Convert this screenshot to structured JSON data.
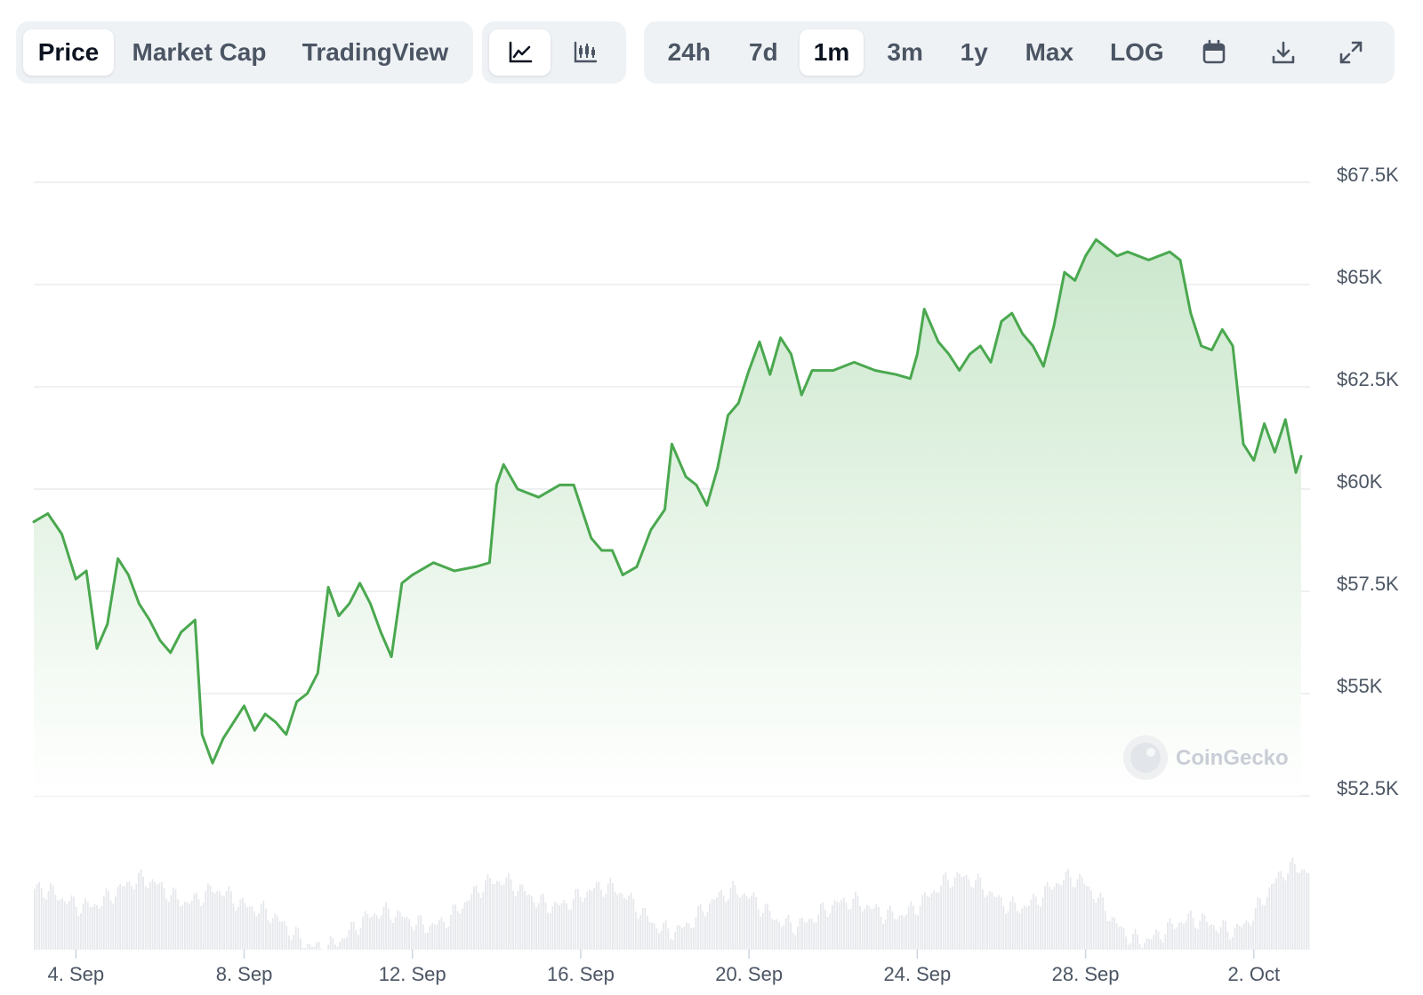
{
  "toolbar": {
    "view_tabs": [
      {
        "label": "Price",
        "active": true
      },
      {
        "label": "Market Cap",
        "active": false
      },
      {
        "label": "TradingView",
        "active": false
      }
    ],
    "chart_types": [
      {
        "icon": "line-chart-icon",
        "active": true
      },
      {
        "icon": "candlestick-chart-icon",
        "active": false
      }
    ],
    "ranges": [
      {
        "label": "24h",
        "active": false
      },
      {
        "label": "7d",
        "active": false
      },
      {
        "label": "1m",
        "active": true
      },
      {
        "label": "3m",
        "active": false
      },
      {
        "label": "1y",
        "active": false
      },
      {
        "label": "Max",
        "active": false
      }
    ],
    "log_label": "LOG",
    "icons": [
      "calendar-icon",
      "download-icon",
      "expand-icon"
    ]
  },
  "watermark": "CoinGecko",
  "colors": {
    "line": "#4aa84f",
    "fill_top": "#c8e6c9",
    "grid": "#e5e7eb",
    "volume": "#e6e8ec",
    "active_bg": "#ffffff",
    "group_bg": "#eff2f5"
  },
  "chart_data": {
    "type": "area",
    "x_axis_type": "date",
    "xlim": [
      "2024-09-03",
      "2024-10-03"
    ],
    "y_axis_labels": [
      "$52.5K",
      "$55K",
      "$57.5K",
      "$60K",
      "$62.5K",
      "$65K",
      "$67.5K"
    ],
    "ylim": [
      52500,
      67500
    ],
    "x_axis_labels": [
      "4. Sep",
      "8. Sep",
      "12. Sep",
      "16. Sep",
      "20. Sep",
      "24. Sep",
      "28. Sep",
      "2. Oct"
    ],
    "x_axis_label_dates": [
      "2024-09-04",
      "2024-09-08",
      "2024-09-12",
      "2024-09-16",
      "2024-09-20",
      "2024-09-24",
      "2024-09-28",
      "2024-10-02"
    ],
    "grid": true,
    "series": [
      {
        "values": [
          [
            "2024-09-03T00:00",
            59200
          ],
          [
            "2024-09-03T08:00",
            59400
          ],
          [
            "2024-09-03T16:00",
            58900
          ],
          [
            "2024-09-04T00:00",
            57800
          ],
          [
            "2024-09-04T06:00",
            58000
          ],
          [
            "2024-09-04T12:00",
            56100
          ],
          [
            "2024-09-04T18:00",
            56700
          ],
          [
            "2024-09-05T00:00",
            58300
          ],
          [
            "2024-09-05T06:00",
            57900
          ],
          [
            "2024-09-05T12:00",
            57200
          ],
          [
            "2024-09-05T18:00",
            56800
          ],
          [
            "2024-09-06T00:00",
            56300
          ],
          [
            "2024-09-06T06:00",
            56000
          ],
          [
            "2024-09-06T12:00",
            56500
          ],
          [
            "2024-09-06T20:00",
            56800
          ],
          [
            "2024-09-07T00:00",
            54000
          ],
          [
            "2024-09-07T06:00",
            53300
          ],
          [
            "2024-09-07T12:00",
            53900
          ],
          [
            "2024-09-07T18:00",
            54300
          ],
          [
            "2024-09-08T00:00",
            54700
          ],
          [
            "2024-09-08T06:00",
            54100
          ],
          [
            "2024-09-08T12:00",
            54500
          ],
          [
            "2024-09-08T18:00",
            54300
          ],
          [
            "2024-09-09T00:00",
            54000
          ],
          [
            "2024-09-09T06:00",
            54800
          ],
          [
            "2024-09-09T12:00",
            55000
          ],
          [
            "2024-09-09T18:00",
            55500
          ],
          [
            "2024-09-10T00:00",
            57600
          ],
          [
            "2024-09-10T06:00",
            56900
          ],
          [
            "2024-09-10T12:00",
            57200
          ],
          [
            "2024-09-10T18:00",
            57700
          ],
          [
            "2024-09-11T00:00",
            57200
          ],
          [
            "2024-09-11T06:00",
            56500
          ],
          [
            "2024-09-11T12:00",
            55900
          ],
          [
            "2024-09-11T18:00",
            57700
          ],
          [
            "2024-09-12T00:00",
            57900
          ],
          [
            "2024-09-12T12:00",
            58200
          ],
          [
            "2024-09-13T00:00",
            58000
          ],
          [
            "2024-09-13T12:00",
            58100
          ],
          [
            "2024-09-13T20:00",
            58200
          ],
          [
            "2024-09-14T00:00",
            60100
          ],
          [
            "2024-09-14T04:00",
            60600
          ],
          [
            "2024-09-14T12:00",
            60000
          ],
          [
            "2024-09-15T00:00",
            59800
          ],
          [
            "2024-09-15T12:00",
            60100
          ],
          [
            "2024-09-15T20:00",
            60100
          ],
          [
            "2024-09-16T06:00",
            58800
          ],
          [
            "2024-09-16T12:00",
            58500
          ],
          [
            "2024-09-16T18:00",
            58500
          ],
          [
            "2024-09-17T00:00",
            57900
          ],
          [
            "2024-09-17T08:00",
            58100
          ],
          [
            "2024-09-17T16:00",
            59000
          ],
          [
            "2024-09-18T00:00",
            59500
          ],
          [
            "2024-09-18T04:00",
            61100
          ],
          [
            "2024-09-18T12:00",
            60300
          ],
          [
            "2024-09-18T18:00",
            60100
          ],
          [
            "2024-09-19T00:00",
            59600
          ],
          [
            "2024-09-19T06:00",
            60500
          ],
          [
            "2024-09-19T12:00",
            61800
          ],
          [
            "2024-09-19T18:00",
            62100
          ],
          [
            "2024-09-20T00:00",
            62900
          ],
          [
            "2024-09-20T06:00",
            63600
          ],
          [
            "2024-09-20T12:00",
            62800
          ],
          [
            "2024-09-20T18:00",
            63700
          ],
          [
            "2024-09-21T00:00",
            63300
          ],
          [
            "2024-09-21T06:00",
            62300
          ],
          [
            "2024-09-21T12:00",
            62900
          ],
          [
            "2024-09-22T00:00",
            62900
          ],
          [
            "2024-09-22T12:00",
            63100
          ],
          [
            "2024-09-23T00:00",
            62900
          ],
          [
            "2024-09-23T12:00",
            62800
          ],
          [
            "2024-09-23T20:00",
            62700
          ],
          [
            "2024-09-24T00:00",
            63300
          ],
          [
            "2024-09-24T04:00",
            64400
          ],
          [
            "2024-09-24T12:00",
            63600
          ],
          [
            "2024-09-24T18:00",
            63300
          ],
          [
            "2024-09-25T00:00",
            62900
          ],
          [
            "2024-09-25T06:00",
            63300
          ],
          [
            "2024-09-25T12:00",
            63500
          ],
          [
            "2024-09-25T18:00",
            63100
          ],
          [
            "2024-09-26T00:00",
            64100
          ],
          [
            "2024-09-26T06:00",
            64300
          ],
          [
            "2024-09-26T12:00",
            63800
          ],
          [
            "2024-09-26T18:00",
            63500
          ],
          [
            "2024-09-27T00:00",
            63000
          ],
          [
            "2024-09-27T06:00",
            64000
          ],
          [
            "2024-09-27T12:00",
            65300
          ],
          [
            "2024-09-27T18:00",
            65100
          ],
          [
            "2024-09-28T00:00",
            65700
          ],
          [
            "2024-09-28T06:00",
            66100
          ],
          [
            "2024-09-28T12:00",
            65900
          ],
          [
            "2024-09-28T18:00",
            65700
          ],
          [
            "2024-09-29T00:00",
            65800
          ],
          [
            "2024-09-29T12:00",
            65600
          ],
          [
            "2024-09-30T00:00",
            65800
          ],
          [
            "2024-09-30T06:00",
            65600
          ],
          [
            "2024-09-30T12:00",
            64300
          ],
          [
            "2024-09-30T18:00",
            63500
          ],
          [
            "2024-10-01T00:00",
            63400
          ],
          [
            "2024-10-01T06:00",
            63900
          ],
          [
            "2024-10-01T12:00",
            63500
          ],
          [
            "2024-10-01T18:00",
            61100
          ],
          [
            "2024-10-02T00:00",
            60700
          ],
          [
            "2024-10-02T06:00",
            61600
          ],
          [
            "2024-10-02T12:00",
            60900
          ],
          [
            "2024-10-02T18:00",
            61700
          ],
          [
            "2024-10-03T00:00",
            60400
          ],
          [
            "2024-10-03T03:00",
            60800
          ]
        ]
      }
    ]
  }
}
